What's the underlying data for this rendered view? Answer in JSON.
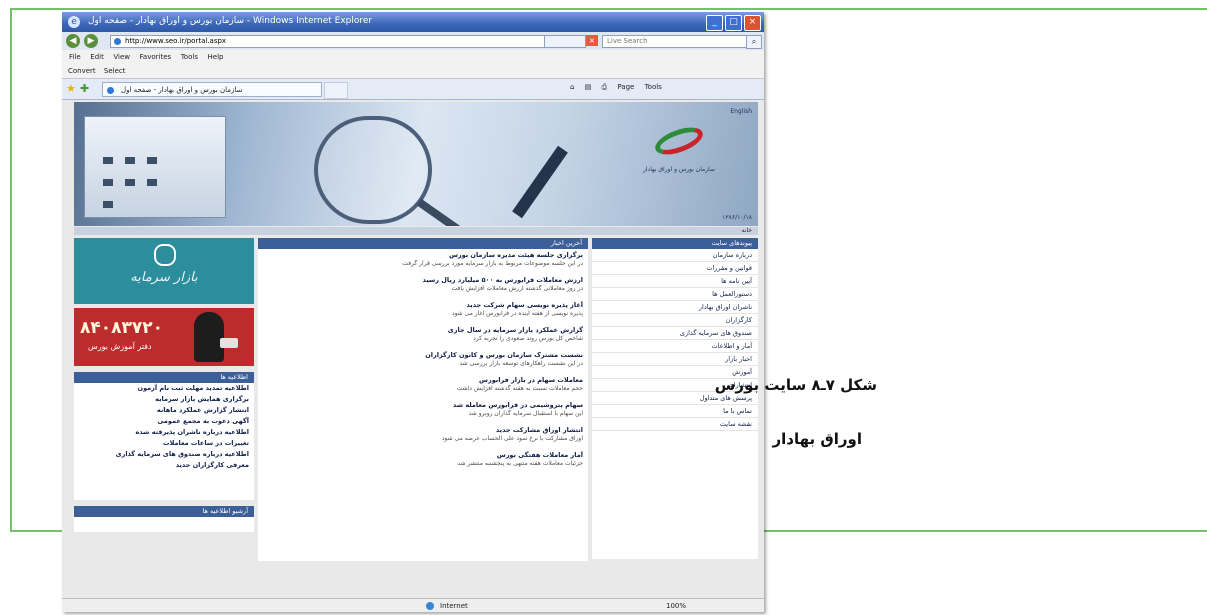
{
  "figure": {
    "caption_line1": "شکل ۷ـ۸ سایت بورس",
    "caption_line2": "اوراق بهادار"
  },
  "window": {
    "title": "سازمان بورس و اوراق بهادار - صفحه اول - Windows Internet Explorer",
    "minimize_label": "_",
    "maximize_label": "□",
    "close_label": "×"
  },
  "browser": {
    "back_label": "◀",
    "forward_label": "▶",
    "address_value": "http://www.seo.ir/portal.aspx",
    "stop_label": "×",
    "search_placeholder": "Live Search",
    "search_button": "⌕",
    "menu": [
      "File",
      "Edit",
      "View",
      "Favorites",
      "Tools",
      "Help"
    ],
    "links": [
      "Convert",
      "Select"
    ],
    "tab_title": "سازمان بورس و اوراق بهادار - صفحه اول",
    "toolbar": [
      "Page",
      "Tools"
    ],
    "status_zone": "Internet",
    "status_zoom": "100%"
  },
  "site": {
    "banner_link": "English",
    "banner_date": "۱۳۸۶/۱۰/۱۸",
    "logo_text": "سازمان بورس و اوراق بهادار",
    "strip_text": "خانه",
    "left_column": {
      "ad1_caption": "بازار سرمایه",
      "ad2_number": "۸۴۰۸۳۷۲۰",
      "ad2_caption": "دفتر آموزش بورس",
      "news_header": "اطلاعیه ها",
      "news": [
        "اطلاعیه تمدید مهلت ثبت نام آزمون",
        "برگزاری همایش بازار سرمایه",
        "انتشار گزارش عملکرد ماهانه",
        "آگهی دعوت به مجمع عمومی",
        "اطلاعیه درباره ناشران پذیرفته شده",
        "تغییرات در ساعات معاملات",
        "اطلاعیه درباره صندوق های سرمایه گذاری",
        "معرفی کارگزاران جدید"
      ],
      "bottom_header": "آرشیو اطلاعیه ها"
    },
    "middle_column": {
      "header": "آخرین اخبار",
      "items": [
        {
          "title": "برگزاری جلسه هیئت مدیره سازمان بورس",
          "text": "در این جلسه موضوعات مربوط به بازار سرمایه مورد بررسی قرار گرفت"
        },
        {
          "title": "ارزش معاملات فرابورس به ۵۰۰ میلیارد ریال رسید",
          "text": "در روز معاملاتی گذشته ارزش معاملات افزایش یافت"
        },
        {
          "title": "آغاز پذیره نویسی سهام شرکت جدید",
          "text": "پذیره نویسی از هفته آینده در فرابورس آغاز می شود"
        },
        {
          "title": "گزارش عملکرد بازار سرمایه در سال جاری",
          "text": "شاخص کل بورس روند صعودی را تجربه کرد"
        },
        {
          "title": "نشست مشترک سازمان بورس و کانون کارگزاران",
          "text": "در این نشست راهکارهای توسعه بازار بررسی شد"
        },
        {
          "title": "معاملات سهام در بازار فرابورس",
          "text": "حجم معاملات نسبت به هفته گذشته افزایش داشت"
        },
        {
          "title": "سهام پتروشیمی در فرابورس معامله شد",
          "text": "این سهام با استقبال سرمایه گذاران روبرو شد"
        },
        {
          "title": "انتشار اوراق مشارکت جدید",
          "text": "اوراق مشارکت با نرخ سود علی الحساب عرضه می شود"
        },
        {
          "title": "آمار معاملات هفتگی بورس",
          "text": "جزئیات معاملات هفته منتهی به پنجشنبه منتشر شد"
        }
      ]
    },
    "right_column": {
      "header": "پیوندهای سایت",
      "items": [
        "درباره سازمان",
        "قوانین و مقررات",
        "آیین نامه ها",
        "دستورالعمل ها",
        "ناشران اوراق بهادار",
        "کارگزاران",
        "صندوق های سرمایه گذاری",
        "آمار و اطلاعات",
        "اخبار بازار",
        "آموزش",
        "انتشارات",
        "پرسش های متداول",
        "تماس با ما",
        "نقشه سایت"
      ]
    }
  }
}
